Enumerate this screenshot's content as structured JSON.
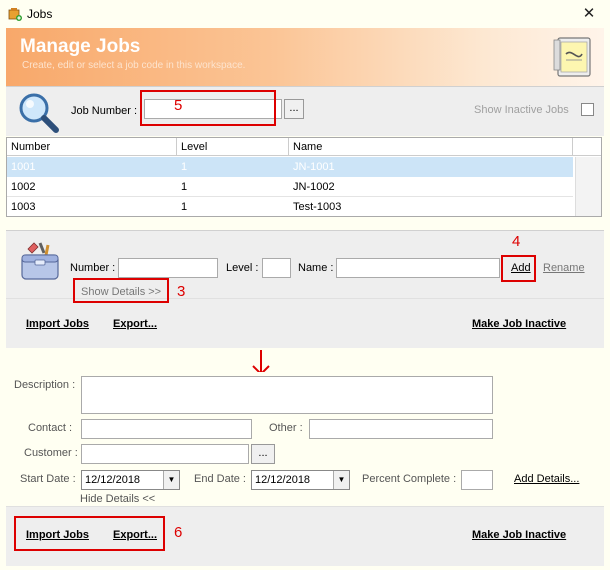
{
  "window": {
    "title": "Jobs",
    "close_symbol": "✕"
  },
  "header": {
    "title": "Manage Jobs",
    "subtitle": "Create, edit or select a job code in this workspace.",
    "note_icon": "notepad-icon"
  },
  "search": {
    "job_number_label": "Job Number :",
    "job_number_value": "",
    "browse_label": "...",
    "show_inactive_label": "Show Inactive Jobs",
    "show_inactive_checked": false
  },
  "table": {
    "columns": [
      "Number",
      "Level",
      "Name"
    ],
    "rows": [
      {
        "number": "1001",
        "level": "1",
        "name": "JN-1001",
        "selected": true
      },
      {
        "number": "1002",
        "level": "1",
        "name": "JN-1002",
        "selected": false
      },
      {
        "number": "1003",
        "level": "1",
        "name": "Test-1003",
        "selected": false
      }
    ]
  },
  "add_form": {
    "number_label": "Number :",
    "level_label": "Level :",
    "name_label": "Name :",
    "number_value": "",
    "level_value": "",
    "name_value": "",
    "add_label": "Add",
    "rename_label": "Rename",
    "show_details_label": "Show Details >>"
  },
  "action_bar_top": {
    "import_label": "Import Jobs",
    "export_label": "Export...",
    "inactive_label": "Make Job Inactive"
  },
  "details": {
    "description_label": "Description :",
    "description_value": "",
    "contact_label": "Contact :",
    "contact_value": "",
    "other_label": "Other :",
    "other_value": "",
    "customer_label": "Customer :",
    "customer_value": "",
    "customer_browse_label": "...",
    "start_date_label": "Start Date :",
    "start_date_value": "12/12/2018",
    "end_date_label": "End Date :",
    "end_date_value": "12/12/2018",
    "percent_label": "Percent Complete :",
    "percent_value": "",
    "add_details_label": "Add Details...",
    "hide_details_label": "Hide Details <<"
  },
  "action_bar_bottom": {
    "import_label": "Import Jobs",
    "export_label": "Export...",
    "inactive_label": "Make Job Inactive"
  },
  "annotations": {
    "n3": "3",
    "n4": "4",
    "n5": "5",
    "n6": "6",
    "color": "#dd0000"
  },
  "colors": {
    "header_accent": "#f8a86a",
    "selected_row": "#cce4f7",
    "panel_bg": "#eeeeee",
    "window_bg": "#fffff2"
  }
}
